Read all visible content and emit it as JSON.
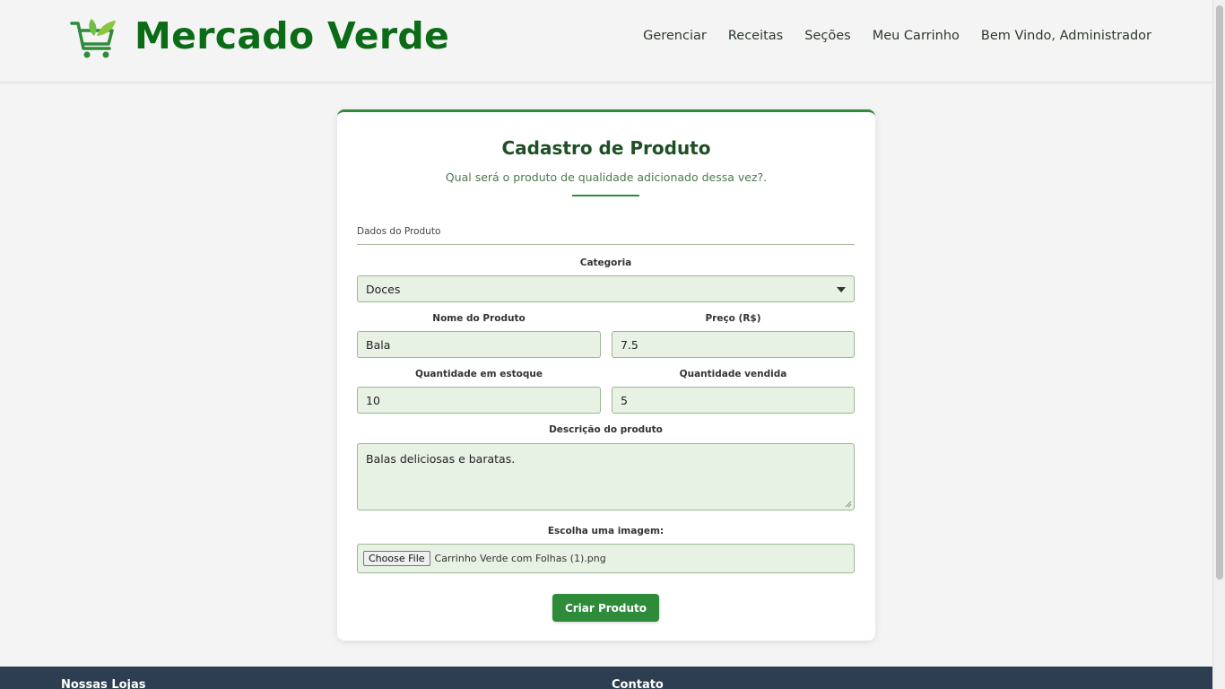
{
  "header": {
    "brand": "Mercado Verde",
    "nav": [
      "Gerenciar",
      "Receitas",
      "Seções",
      "Meu Carrinho",
      "Bem Vindo, Administrador"
    ]
  },
  "form": {
    "title": "Cadastro de Produto",
    "subtitle": "Qual será o produto de qualidade adicionado dessa vez?.",
    "section": "Dados do Produto",
    "category": {
      "label": "Categoria",
      "value": "Doces"
    },
    "name": {
      "label": "Nome do Produto",
      "value": "Bala"
    },
    "price": {
      "label": "Preço (R$)",
      "value": "7.5"
    },
    "stock": {
      "label": "Quantidade em estoque",
      "value": "10"
    },
    "sold": {
      "label": "Quantidade vendida",
      "value": "5"
    },
    "description": {
      "label": "Descrição do produto",
      "value": "Balas deliciosas e baratas."
    },
    "image": {
      "label": "Escolha uma imagem:",
      "button": "Choose File",
      "filename": "Carrinho Verde com Folhas (1).png"
    },
    "submit": "Criar Produto"
  },
  "footer": {
    "stores": "Nossas Lojas",
    "contact": "Contato"
  },
  "colors": {
    "brand": "#0b6b17",
    "accent": "#2e8b3a",
    "field_bg": "#e8f2e4",
    "footer": "#2c3e50"
  },
  "icons": [
    "shopping-cart-leaves-icon",
    "chevron-down-icon"
  ]
}
